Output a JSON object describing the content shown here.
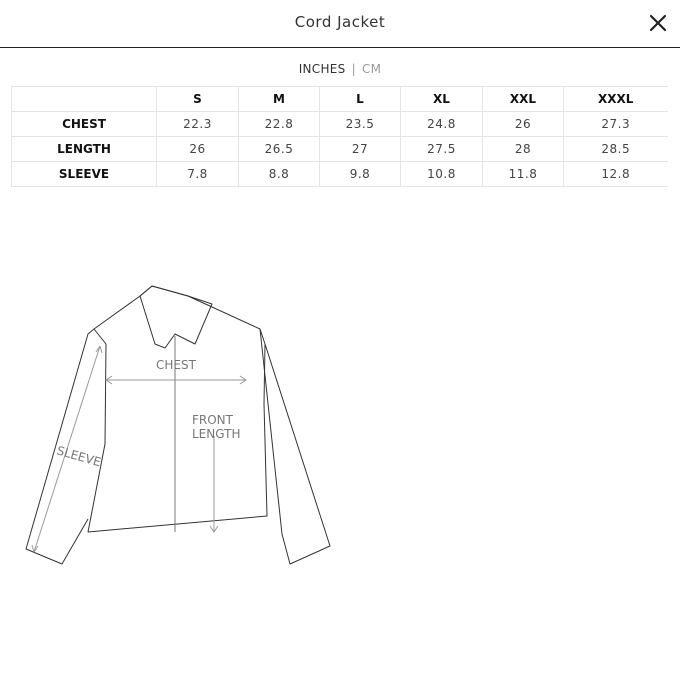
{
  "header": {
    "title": "Cord Jacket",
    "close_icon": "close-icon"
  },
  "units": {
    "active": "INCHES",
    "separator": "|",
    "inactive": "CM"
  },
  "table": {
    "columns": [
      "",
      "S",
      "M",
      "L",
      "XL",
      "XXL",
      "XXXL"
    ],
    "rows": [
      {
        "label": "CHEST",
        "values": [
          "22.3",
          "22.8",
          "23.5",
          "24.8",
          "26",
          "27.3"
        ]
      },
      {
        "label": "LENGTH",
        "values": [
          "26",
          "26.5",
          "27",
          "27.5",
          "28",
          "28.5"
        ]
      },
      {
        "label": "SLEEVE",
        "values": [
          "7.8",
          "8.8",
          "9.8",
          "10.8",
          "11.8",
          "12.8"
        ]
      }
    ]
  },
  "diagram": {
    "chest_label": "CHEST",
    "front_length_label_1": "FRONT",
    "front_length_label_2": "LENGTH",
    "sleeve_label": "SLEEVE"
  },
  "colors": {
    "line": "#222222",
    "measure": "#999999",
    "border": "#e4e4e4"
  }
}
